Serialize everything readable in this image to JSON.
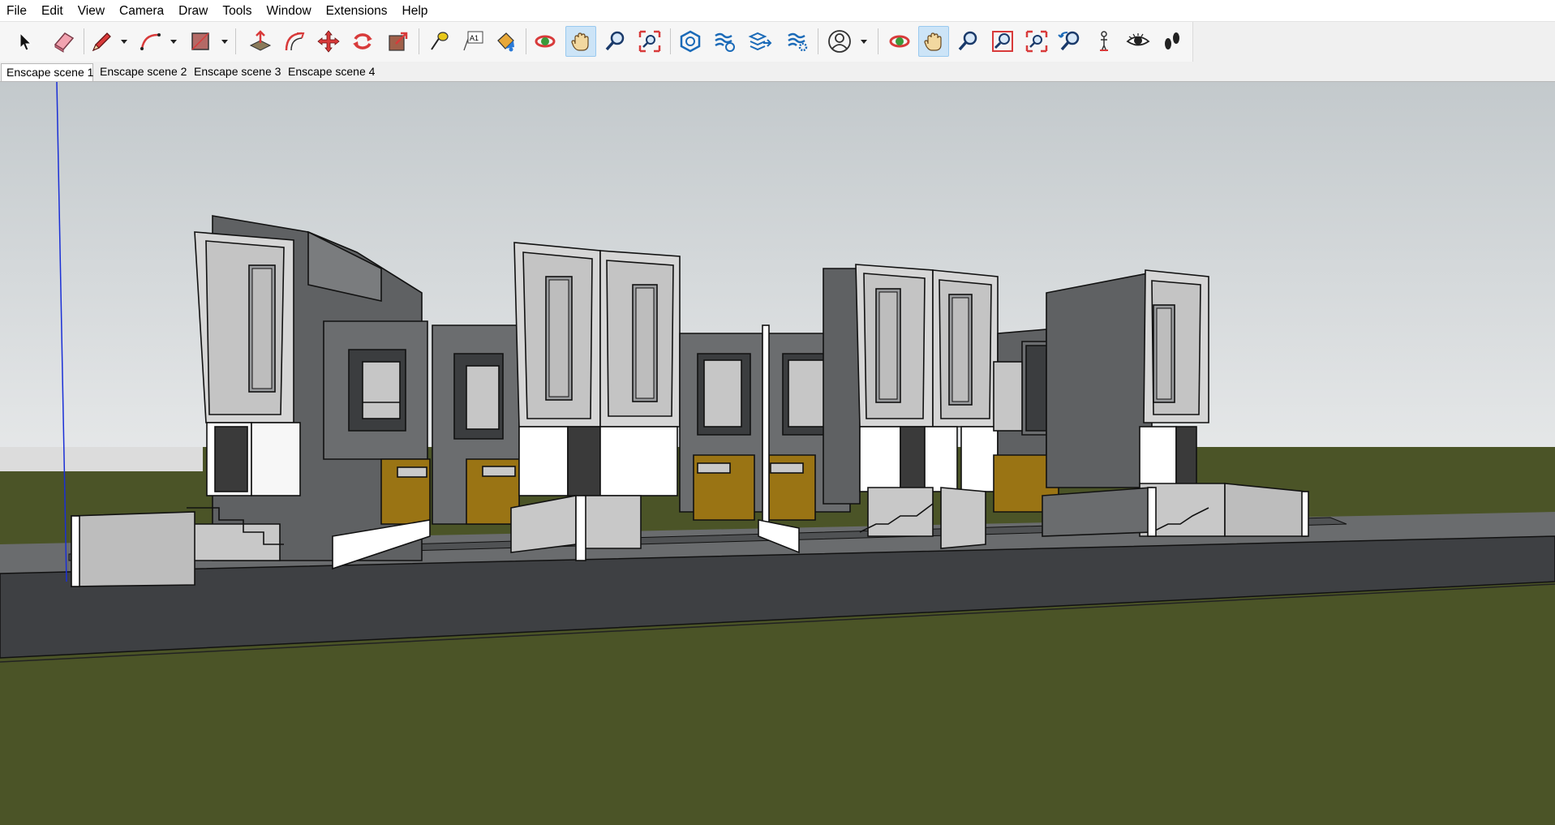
{
  "menu": [
    "File",
    "Edit",
    "View",
    "Camera",
    "Draw",
    "Tools",
    "Window",
    "Extensions",
    "Help"
  ],
  "toolbar": {
    "tools": [
      {
        "name": "select-tool-icon"
      },
      {
        "name": "eraser-tool-icon"
      },
      {
        "name": "pencil-line-tool-icon"
      },
      {
        "name": "arc-tool-icon"
      },
      {
        "name": "rectangle-tool-icon"
      },
      {
        "name": "push-pull-tool-icon"
      },
      {
        "name": "offset-tool-icon"
      },
      {
        "name": "move-tool-icon"
      },
      {
        "name": "rotate-tool-icon"
      },
      {
        "name": "scale-tool-icon"
      },
      {
        "name": "tape-measure-tool-icon"
      },
      {
        "name": "text-tool-icon"
      },
      {
        "name": "paint-bucket-tool-icon"
      },
      {
        "name": "orbit-tool-icon"
      },
      {
        "name": "pan-tool-icon"
      },
      {
        "name": "zoom-tool-icon"
      },
      {
        "name": "zoom-extents-tool-icon"
      },
      {
        "name": "enscape-start-icon"
      },
      {
        "name": "enscape-sync-icon"
      },
      {
        "name": "enscape-export-icon"
      },
      {
        "name": "enscape-settings-icon"
      },
      {
        "name": "account-icon"
      },
      {
        "name": "orbit-2-icon"
      },
      {
        "name": "pan-2-icon"
      },
      {
        "name": "zoom-2-icon"
      },
      {
        "name": "zoom-window-icon"
      },
      {
        "name": "zoom-extents-2-icon"
      },
      {
        "name": "previous-view-icon"
      },
      {
        "name": "position-camera-icon"
      },
      {
        "name": "look-around-icon"
      },
      {
        "name": "walk-icon"
      }
    ],
    "active_tool": "pan-tool-icon",
    "text_tool_label": "A1"
  },
  "scenes": {
    "tabs": [
      "Enscape scene 1",
      "Enscape scene 2",
      "Enscape scene 3",
      "Enscape scene 4"
    ],
    "active_index": 0
  },
  "colors": {
    "sky": "#cdd3d6",
    "ground": "#4b5427",
    "road": "#3e4043",
    "facade_dark": "#5a5c5e",
    "facade_light": "#d8d8d8",
    "door_accent": "#9a7414",
    "blue_axis": "#1a2fd6",
    "toolbar_active": "#cce4f7"
  }
}
